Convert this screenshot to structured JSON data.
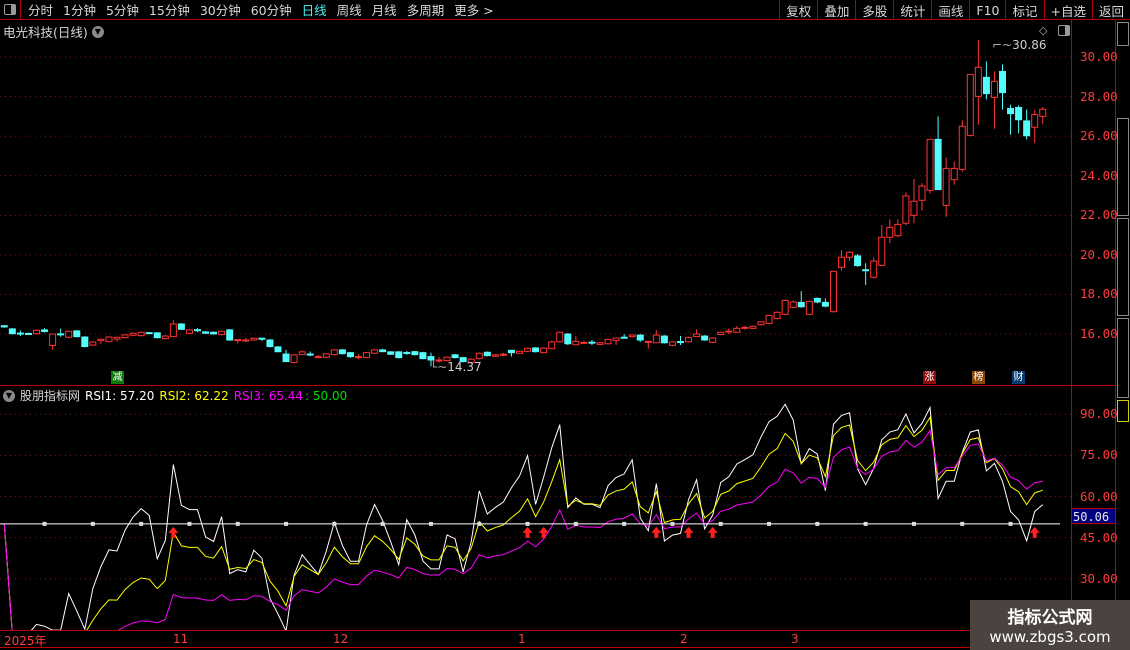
{
  "toolbar": {
    "periods": [
      "分时",
      "1分钟",
      "5分钟",
      "15分钟",
      "30分钟",
      "60分钟",
      "日线",
      "周线",
      "月线",
      "多周期",
      "更多 >"
    ],
    "active_period": "日线",
    "buttons": [
      "复权",
      "叠加",
      "多股",
      "统计",
      "画线",
      "F10",
      "标记",
      "+自选",
      "返回"
    ]
  },
  "title": "电光科技(日线)",
  "price_axis": [
    "30.00",
    "28.00",
    "26.00",
    "24.00",
    "22.00",
    "20.00",
    "18.00",
    "16.00"
  ],
  "rsi_axis": [
    "90.00",
    "75.00",
    "60.00",
    "45.00",
    "30.00"
  ],
  "rsi_current": "50.06",
  "indicator": {
    "name": "股朋指标网",
    "rsi1": "RSI1: 57.20",
    "rsi2": "RSI2: 62.22",
    "rsi3": "RSI3: 65.44",
    "level": ": 50.00"
  },
  "high_label": "30.86",
  "low_label": "14.37",
  "badges": {
    "jian": "减",
    "zhang": "涨",
    "bang": "榜",
    "cai": "财"
  },
  "dates": [
    "2025年",
    "11",
    "12",
    "1",
    "2",
    "3"
  ],
  "watermark": {
    "line1": "指标公式网",
    "line2": "www.zbgs3.com"
  },
  "colors": {
    "up": "#ff3232",
    "down": "#54fcfc",
    "rsi1": "#ffffff",
    "rsi2": "#ffff00",
    "rsi3": "#ff00ff",
    "level": "#ffffff",
    "signal": "#ff2020"
  },
  "chart_data": {
    "type": "candlestick",
    "title": "电光科技(日线)",
    "candle_format": "[open, close, high, low]",
    "ylim": [
      13.8,
      31.2
    ],
    "candles": [
      [
        16.42,
        16.36
      ],
      [
        16.26,
        16.02
      ],
      [
        16.05,
        16.04,
        16.18,
        15.9
      ],
      [
        16.03,
        16.02
      ],
      [
        16.02,
        16.19
      ],
      [
        16.21,
        16.13,
        16.3,
        16.08
      ],
      [
        15.42,
        16.0,
        16.0,
        15.2
      ],
      [
        16.01,
        16.0,
        16.28,
        15.86
      ],
      [
        15.84,
        16.14
      ],
      [
        16.16,
        15.87
      ],
      [
        15.85,
        15.37
      ],
      [
        15.44,
        15.6
      ],
      [
        15.67,
        15.74,
        15.74,
        15.5
      ],
      [
        15.62,
        15.85
      ],
      [
        15.75,
        15.84,
        15.84,
        15.62
      ],
      [
        15.82,
        15.96
      ],
      [
        15.94,
        16.04
      ],
      [
        15.92,
        16.09
      ],
      [
        16.07,
        16.06,
        16.1,
        16.0
      ],
      [
        16.06,
        15.82
      ],
      [
        15.77,
        15.9
      ],
      [
        15.87,
        16.51,
        16.7,
        15.87
      ],
      [
        16.51,
        16.24
      ],
      [
        16.04,
        16.21
      ],
      [
        16.22,
        16.21,
        16.3,
        16.1
      ],
      [
        16.11,
        16.04
      ],
      [
        16.09,
        16.01
      ],
      [
        15.97,
        16.14
      ],
      [
        16.21,
        15.7
      ],
      [
        15.72,
        15.72,
        15.72,
        15.52
      ],
      [
        15.7,
        15.7,
        15.8,
        15.6
      ],
      [
        15.7,
        15.79
      ],
      [
        15.79,
        15.74,
        15.79,
        15.65
      ],
      [
        15.7,
        15.37
      ],
      [
        15.35,
        15.11
      ],
      [
        14.99,
        14.61,
        15.2,
        14.6
      ],
      [
        14.56,
        14.95
      ],
      [
        14.96,
        15.1,
        15.17,
        14.96
      ],
      [
        14.99,
        14.98,
        15.12,
        14.88
      ],
      [
        14.86,
        14.86,
        14.95,
        14.86
      ],
      [
        14.83,
        15.0
      ],
      [
        14.96,
        15.2
      ],
      [
        15.2,
        15.01
      ],
      [
        15.06,
        14.86,
        15.1,
        14.8
      ],
      [
        14.86,
        14.86,
        14.99,
        14.73
      ],
      [
        14.81,
        15.06
      ],
      [
        15.03,
        15.2
      ],
      [
        15.2,
        15.11,
        15.25,
        15.11
      ],
      [
        15.1,
        14.98
      ],
      [
        15.1,
        14.81
      ],
      [
        15.07,
        15.06,
        15.15,
        14.95
      ],
      [
        15.11,
        14.96
      ],
      [
        15.06,
        14.76
      ],
      [
        14.86,
        14.69,
        15.06,
        14.37
      ],
      [
        14.69,
        14.69,
        14.86,
        14.55
      ],
      [
        14.66,
        14.83
      ],
      [
        14.95,
        14.81
      ],
      [
        14.81,
        14.61
      ],
      [
        14.56,
        14.73
      ],
      [
        14.76,
        15.03
      ],
      [
        15.08,
        14.91
      ],
      [
        14.88,
        14.95
      ],
      [
        14.98,
        14.98,
        15.05,
        14.88
      ],
      [
        15.18,
        15.06,
        15.18,
        14.86
      ],
      [
        15.03,
        15.13
      ],
      [
        15.13,
        15.28
      ],
      [
        15.3,
        15.11
      ],
      [
        15.06,
        15.29
      ],
      [
        15.26,
        15.6,
        15.67,
        15.26
      ],
      [
        15.61,
        16.09
      ],
      [
        16.0,
        15.51,
        16.05,
        15.45
      ],
      [
        15.46,
        15.63,
        15.9,
        15.46
      ],
      [
        15.58,
        15.58,
        15.66,
        15.5
      ],
      [
        15.59,
        15.58,
        15.7,
        15.44
      ],
      [
        15.48,
        15.56
      ],
      [
        15.51,
        15.73
      ],
      [
        15.68,
        15.8,
        15.8,
        15.45
      ],
      [
        15.84,
        15.83,
        16.0,
        15.8
      ],
      [
        15.87,
        15.95
      ],
      [
        15.95,
        15.7,
        15.99,
        15.6
      ],
      [
        15.63,
        15.63,
        15.66,
        15.26
      ],
      [
        15.56,
        15.95,
        16.2,
        15.56
      ],
      [
        15.9,
        15.56
      ],
      [
        15.43,
        15.6
      ],
      [
        15.62,
        15.61,
        15.9,
        15.45
      ],
      [
        15.61,
        15.83
      ],
      [
        15.87,
        16.0,
        16.24,
        15.87
      ],
      [
        15.9,
        15.7
      ],
      [
        15.58,
        15.8
      ],
      [
        15.98,
        16.09
      ],
      [
        16.15,
        16.15,
        16.28,
        16.0
      ],
      [
        16.09,
        16.29,
        16.4,
        16.09
      ],
      [
        16.34,
        16.34,
        16.42,
        16.22
      ],
      [
        16.29,
        16.39
      ],
      [
        16.47,
        16.62
      ],
      [
        16.54,
        16.94
      ],
      [
        16.78,
        17.1
      ],
      [
        17.0,
        17.7
      ],
      [
        17.35,
        17.62,
        17.7,
        17.35
      ],
      [
        17.6,
        17.38,
        18.17,
        17.33
      ],
      [
        17.0,
        17.65
      ],
      [
        17.8,
        17.62,
        17.85,
        17.55
      ],
      [
        17.6,
        17.41,
        17.8,
        17.35
      ],
      [
        17.13,
        19.17
      ],
      [
        19.37,
        19.88,
        20.25,
        19.2
      ],
      [
        19.88,
        20.13,
        20.2,
        19.7
      ],
      [
        19.95,
        19.46,
        20.05,
        19.4
      ],
      [
        19.25,
        19.24,
        19.58,
        18.48
      ],
      [
        18.87,
        19.69,
        19.87,
        18.8
      ],
      [
        19.47,
        20.89,
        21.51,
        19.47
      ],
      [
        20.89,
        21.39,
        21.8,
        20.6
      ],
      [
        20.97,
        21.54,
        21.8,
        20.9
      ],
      [
        21.6,
        22.98,
        23.16,
        21.5
      ],
      [
        22.0,
        22.71,
        23.84,
        21.6
      ],
      [
        22.76,
        23.48,
        23.62,
        22.23
      ],
      [
        23.26,
        25.84,
        25.84,
        23.1
      ],
      [
        25.84,
        23.3,
        27.0,
        23.3
      ],
      [
        22.5,
        24.37,
        24.93,
        21.93
      ],
      [
        23.8,
        24.37,
        24.73,
        23.55
      ],
      [
        24.32,
        26.5,
        26.8,
        24.2
      ],
      [
        26.03,
        29.12,
        29.12,
        26.03
      ],
      [
        28.01,
        29.48,
        30.86,
        26.58
      ],
      [
        28.97,
        28.15,
        29.78,
        27.86
      ],
      [
        27.96,
        28.77,
        29.27,
        26.38
      ],
      [
        29.27,
        28.2,
        29.63,
        27.34
      ],
      [
        27.4,
        27.14,
        27.59,
        26.07
      ],
      [
        27.45,
        26.83,
        27.56,
        26.14
      ],
      [
        26.77,
        26.02,
        27.35,
        25.84
      ],
      [
        26.45,
        27.09,
        27.32,
        25.64
      ],
      [
        27.0,
        27.36,
        27.47,
        26.6
      ]
    ],
    "rsi": {
      "periods": [
        6,
        12,
        24
      ],
      "level": 50,
      "ylim": [
        20,
        100
      ],
      "last": [
        57.2,
        62.22,
        65.44
      ]
    },
    "buy_signals": [
      21,
      65,
      67,
      81,
      85,
      88,
      128
    ],
    "level_markers_every": 6
  }
}
